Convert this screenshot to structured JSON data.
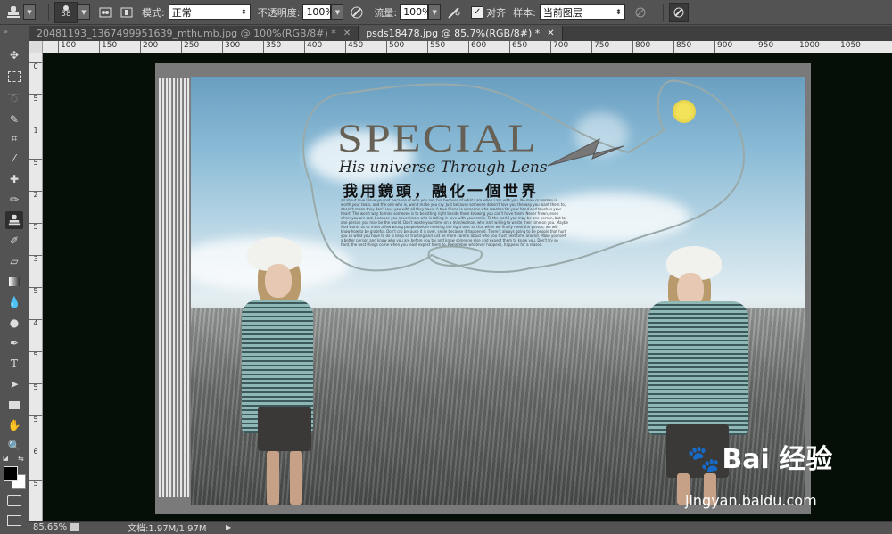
{
  "options_bar": {
    "brush_size": "38",
    "mode_label": "模式:",
    "mode_value": "正常",
    "opacity_label": "不透明度:",
    "opacity_value": "100%",
    "flow_label": "流量:",
    "flow_value": "100%",
    "align_label": "对齐",
    "align_checked": true,
    "sample_label": "样本:",
    "sample_value": "当前图层"
  },
  "tabs": [
    {
      "label": "20481193_1367499951639_mthumb.jpg @ 100%(RGB/8#) *",
      "active": false
    },
    {
      "label": "psds18478.jpg @ 85.7%(RGB/8#) *",
      "active": true
    }
  ],
  "ruler_top_ticks": [
    "100",
    "150",
    "200",
    "250",
    "300",
    "350",
    "400",
    "450",
    "500",
    "550",
    "600",
    "650",
    "700",
    "750",
    "800",
    "850",
    "900",
    "950",
    "1000",
    "1050"
  ],
  "ruler_left_ticks": [
    "0",
    "5",
    "1",
    "5",
    "2",
    "5",
    "3",
    "5",
    "4",
    "5",
    "5",
    "5",
    "6",
    "5"
  ],
  "artwork": {
    "title": "SPECIAL",
    "subtitle": "His universe Through Lens",
    "chinese": "我用鏡頭，融化一個世界",
    "paragraph": "all about love I love you not because of who you are, but because of what I am when I am with you. No man or woman is worth your tears, and the one who is, won't make you cry. Just because someone doesn't love you the way you want them to, doesn't mean they don't love you with all they have. A true friend is someone who reaches for your hand and touches your heart. The worst way to miss someone is to be sitting right beside them knowing you can't have them. Never frown, even when you are sad, because you never know who is falling in love with your smile. To the world you may be one person, but to one person you may be the world. Don't waste your time on a man/woman, who isn't willing to waste their time on you. Maybe God wants us to meet a few wrong people before meeting the right one, so that when we finally meet the person, we will know how to be grateful. Don't cry because it is over, smile because it happened. There's always going to be people that hurt you so what you have to do is keep on trusting and just be more careful about who you trust next time around. Make yourself a better person and know who you are before you try and know someone else and expect them to know you. Don't try so hard, the best things come when you least expect them to. Remember whatever happens, happens for a reason.",
    "watermark_brand": "Bai  经验",
    "watermark_url": "jingyan.baidu.com"
  },
  "status_bar": {
    "zoom": "85.65%",
    "doc_info": "文档:1.97M/1.97M"
  },
  "colors": {
    "ui_bg": "#535353",
    "canvas_bg": "#050f08",
    "sky": "#8cbcd7",
    "sun": "#f3e35a"
  },
  "tools": [
    "move-icon",
    "marquee-icon",
    "lasso-icon",
    "quick-select-icon",
    "crop-icon",
    "eyedropper-icon",
    "healing-icon",
    "brush-icon",
    "clone-stamp-icon",
    "history-brush-icon",
    "eraser-icon",
    "gradient-icon",
    "blur-icon",
    "dodge-icon",
    "pen-icon",
    "type-icon",
    "path-select-icon",
    "shape-icon",
    "hand-icon",
    "zoom-icon"
  ]
}
